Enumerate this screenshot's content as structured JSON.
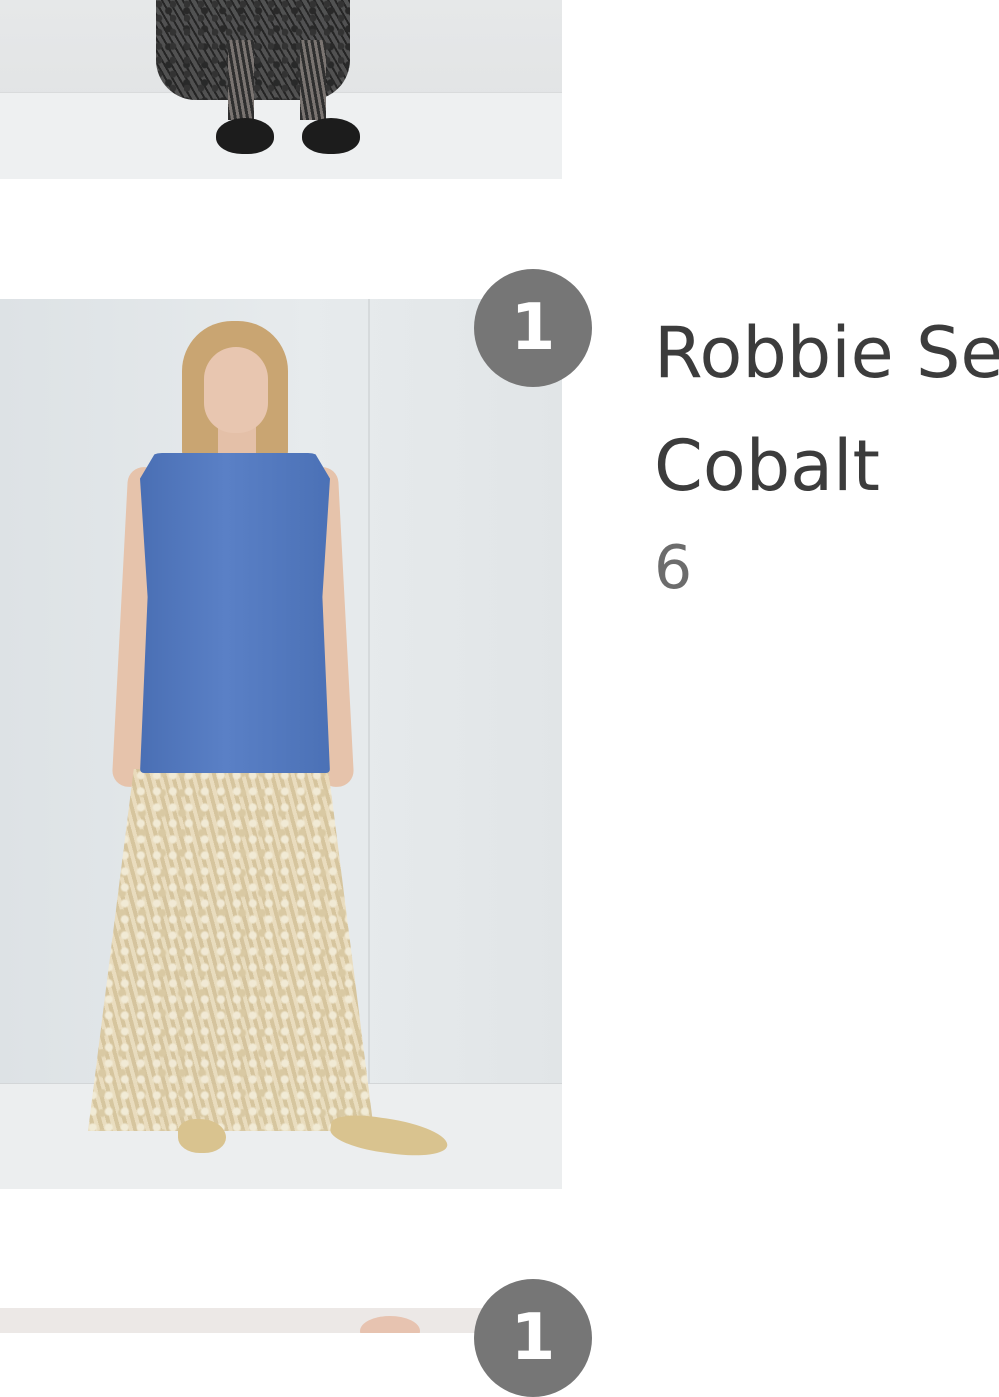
{
  "items": [
    {
      "image_alt": "Black lace maxi skirt with black thong sandals"
    },
    {
      "badge": "1",
      "name": "Robbie Sequin",
      "color": "Cobalt",
      "size": "6",
      "image_alt": "Model wearing cobalt blue sleeveless top with gold sequin lace maxi skirt"
    },
    {
      "badge": "1"
    }
  ],
  "colors": {
    "badge_background": "#767676",
    "badge_text": "#ffffff",
    "text_primary": "#3c3c3c",
    "text_secondary": "#6c6c6c",
    "page_background": "#ffffff"
  }
}
